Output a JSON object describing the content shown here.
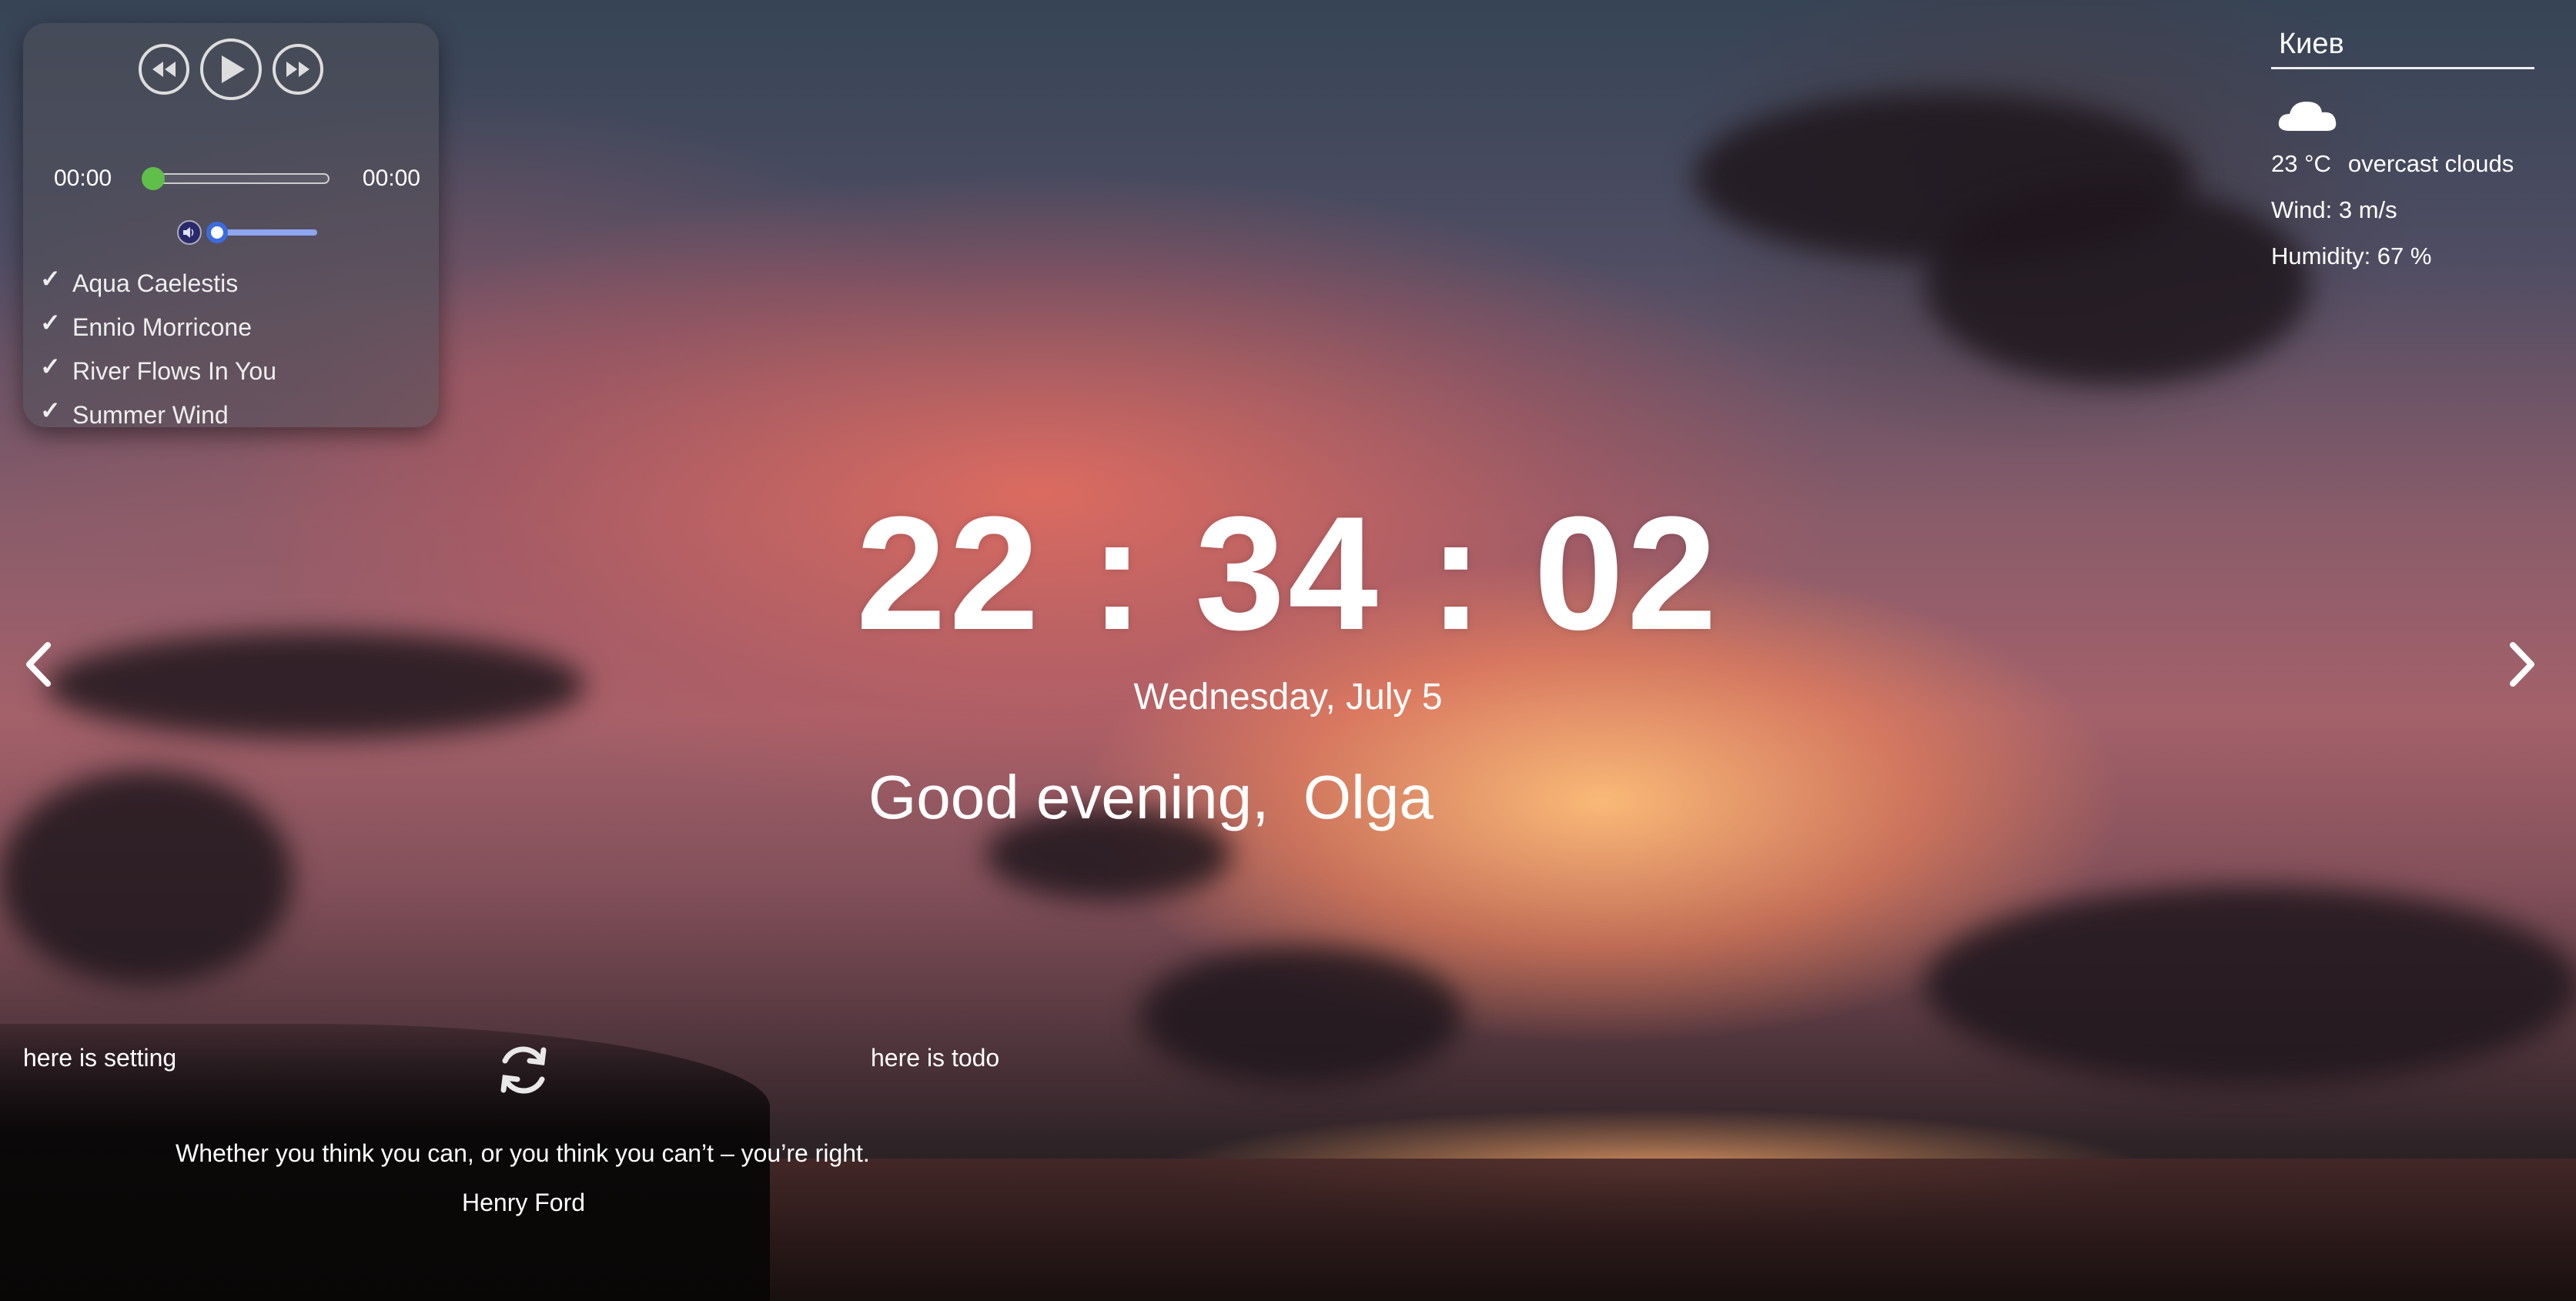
{
  "player": {
    "current_time": "00:00",
    "duration": "00:00",
    "progress": 0,
    "volume": 0,
    "playlist": [
      {
        "title": "Aqua Caelestis"
      },
      {
        "title": "Ennio Morricone"
      },
      {
        "title": "River Flows In You"
      },
      {
        "title": "Summer Wind"
      }
    ],
    "accent_progress": "#5fbf4a",
    "accent_volume": "#3c6be0"
  },
  "weather": {
    "city": "Киев",
    "icon": "cloud-icon",
    "temperature": "23 °C",
    "description": "overcast clouds",
    "wind": "Wind: 3 m/s",
    "humidity": "Humidity: 67 %"
  },
  "clock": {
    "time": "22 : 34 : 02",
    "date": "Wednesday, July 5"
  },
  "greeting": {
    "text": "Good evening,",
    "name": "Olga"
  },
  "footer": {
    "setting": "here is setting",
    "todo": "here is todo",
    "quote": "Whether you think you can, or you think you can’t – you’re right.",
    "author": "Henry Ford"
  }
}
